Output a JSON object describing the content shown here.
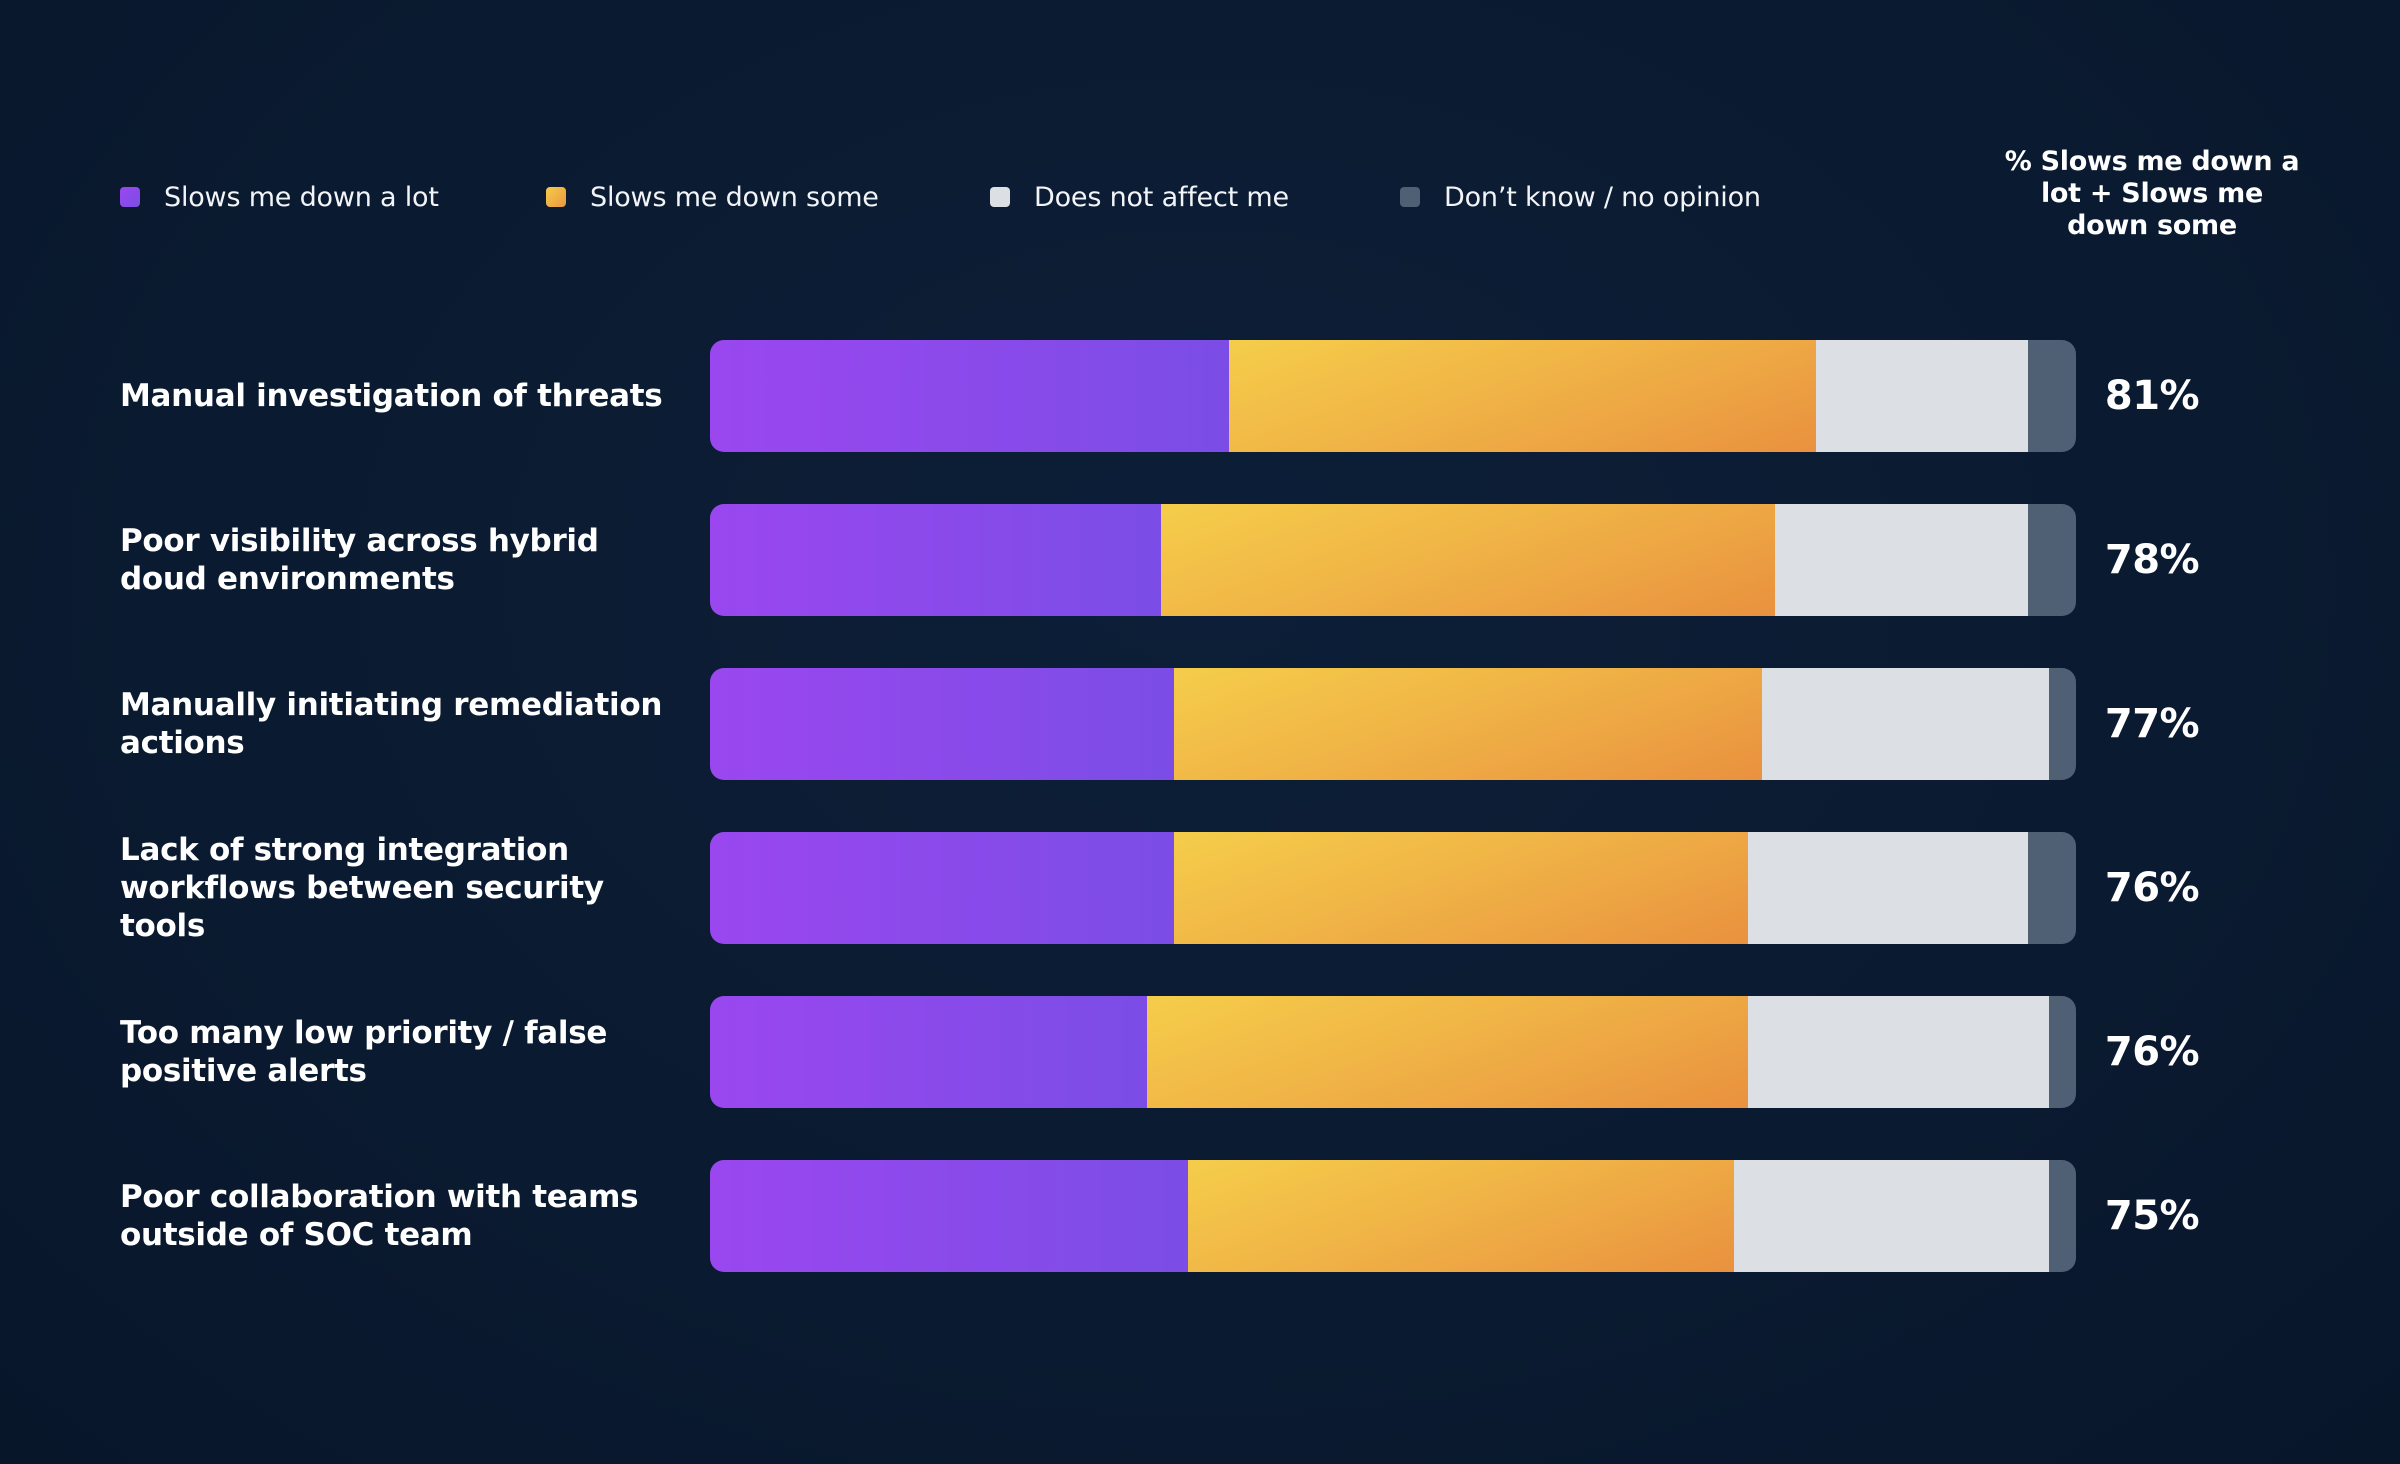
{
  "legend": [
    {
      "label": "Slows me down a lot",
      "color": "#8b4aec",
      "icon": "purple-square-swatch"
    },
    {
      "label": "Slows me down some",
      "color": "#f2b444",
      "icon": "orange-square-swatch"
    },
    {
      "label": "Does not affect me",
      "color": "#dcdfe3",
      "icon": "light-gray-square-swatch"
    },
    {
      "label": "Don’t know / no opinion",
      "color": "#4f5f74",
      "icon": "slate-square-swatch"
    }
  ],
  "total_header": "% Slows me down a lot + Slows me down some",
  "chart_data": {
    "type": "bar",
    "orientation": "horizontal",
    "stacked": true,
    "normalized": true,
    "title": "",
    "xlabel": "",
    "ylabel": "",
    "xlim": [
      0,
      100
    ],
    "grid": false,
    "legend_position": "top",
    "categories": [
      "Manual investigation of threats",
      "Poor visibility across hybrid doud environments",
      "Manually initiating remediation actions",
      "Lack of strong integration workflows between security tools",
      "Too many low priority / false positive alerts",
      "Poor collaboration with teams outside of SOC team"
    ],
    "series": [
      {
        "name": "Slows me down a lot",
        "color": "#8b4aec",
        "values": [
          38,
          33,
          34,
          34,
          32,
          35
        ]
      },
      {
        "name": "Slows me down some",
        "color": "#f2b444",
        "values": [
          43,
          45,
          43,
          42,
          44,
          40
        ]
      },
      {
        "name": "Does not affect me",
        "color": "#dcdfe3",
        "values": [
          15.5,
          18.5,
          21,
          20.5,
          22,
          23
        ]
      },
      {
        "name": "Don’t know / no opinion",
        "color": "#4f5f74",
        "values": [
          3.5,
          3.5,
          2,
          3.5,
          2,
          2
        ]
      }
    ],
    "totals_label": "% Slows me down a lot + Slows me down some",
    "totals": [
      "81%",
      "78%",
      "77%",
      "76%",
      "76%",
      "75%"
    ]
  }
}
